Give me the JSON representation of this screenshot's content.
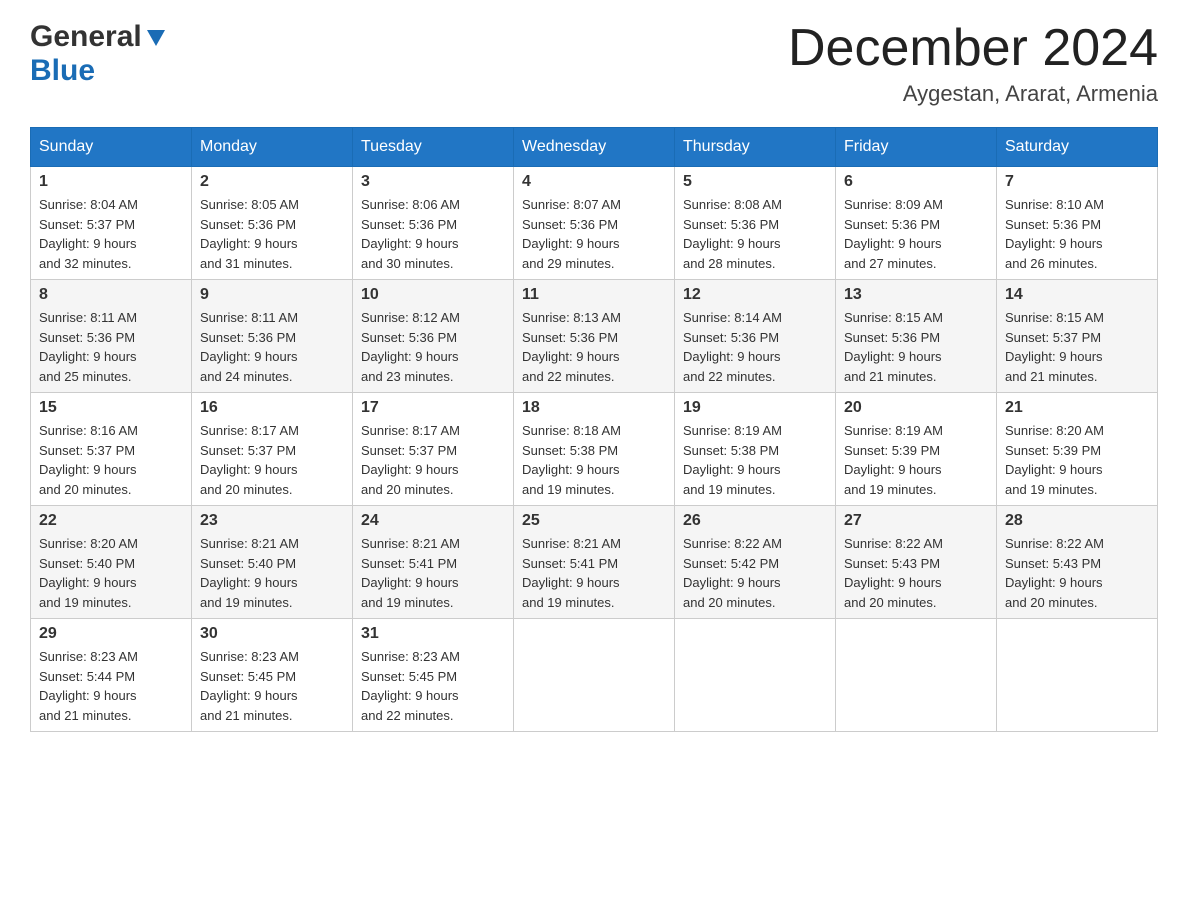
{
  "header": {
    "logo_general": "General",
    "logo_blue": "Blue",
    "title": "December 2024",
    "subtitle": "Aygestan, Ararat, Armenia"
  },
  "calendar": {
    "days_of_week": [
      "Sunday",
      "Monday",
      "Tuesday",
      "Wednesday",
      "Thursday",
      "Friday",
      "Saturday"
    ],
    "weeks": [
      [
        {
          "day": "1",
          "sunrise": "8:04 AM",
          "sunset": "5:37 PM",
          "daylight": "9 hours and 32 minutes."
        },
        {
          "day": "2",
          "sunrise": "8:05 AM",
          "sunset": "5:36 PM",
          "daylight": "9 hours and 31 minutes."
        },
        {
          "day": "3",
          "sunrise": "8:06 AM",
          "sunset": "5:36 PM",
          "daylight": "9 hours and 30 minutes."
        },
        {
          "day": "4",
          "sunrise": "8:07 AM",
          "sunset": "5:36 PM",
          "daylight": "9 hours and 29 minutes."
        },
        {
          "day": "5",
          "sunrise": "8:08 AM",
          "sunset": "5:36 PM",
          "daylight": "9 hours and 28 minutes."
        },
        {
          "day": "6",
          "sunrise": "8:09 AM",
          "sunset": "5:36 PM",
          "daylight": "9 hours and 27 minutes."
        },
        {
          "day": "7",
          "sunrise": "8:10 AM",
          "sunset": "5:36 PM",
          "daylight": "9 hours and 26 minutes."
        }
      ],
      [
        {
          "day": "8",
          "sunrise": "8:11 AM",
          "sunset": "5:36 PM",
          "daylight": "9 hours and 25 minutes."
        },
        {
          "day": "9",
          "sunrise": "8:11 AM",
          "sunset": "5:36 PM",
          "daylight": "9 hours and 24 minutes."
        },
        {
          "day": "10",
          "sunrise": "8:12 AM",
          "sunset": "5:36 PM",
          "daylight": "9 hours and 23 minutes."
        },
        {
          "day": "11",
          "sunrise": "8:13 AM",
          "sunset": "5:36 PM",
          "daylight": "9 hours and 22 minutes."
        },
        {
          "day": "12",
          "sunrise": "8:14 AM",
          "sunset": "5:36 PM",
          "daylight": "9 hours and 22 minutes."
        },
        {
          "day": "13",
          "sunrise": "8:15 AM",
          "sunset": "5:36 PM",
          "daylight": "9 hours and 21 minutes."
        },
        {
          "day": "14",
          "sunrise": "8:15 AM",
          "sunset": "5:37 PM",
          "daylight": "9 hours and 21 minutes."
        }
      ],
      [
        {
          "day": "15",
          "sunrise": "8:16 AM",
          "sunset": "5:37 PM",
          "daylight": "9 hours and 20 minutes."
        },
        {
          "day": "16",
          "sunrise": "8:17 AM",
          "sunset": "5:37 PM",
          "daylight": "9 hours and 20 minutes."
        },
        {
          "day": "17",
          "sunrise": "8:17 AM",
          "sunset": "5:37 PM",
          "daylight": "9 hours and 20 minutes."
        },
        {
          "day": "18",
          "sunrise": "8:18 AM",
          "sunset": "5:38 PM",
          "daylight": "9 hours and 19 minutes."
        },
        {
          "day": "19",
          "sunrise": "8:19 AM",
          "sunset": "5:38 PM",
          "daylight": "9 hours and 19 minutes."
        },
        {
          "day": "20",
          "sunrise": "8:19 AM",
          "sunset": "5:39 PM",
          "daylight": "9 hours and 19 minutes."
        },
        {
          "day": "21",
          "sunrise": "8:20 AM",
          "sunset": "5:39 PM",
          "daylight": "9 hours and 19 minutes."
        }
      ],
      [
        {
          "day": "22",
          "sunrise": "8:20 AM",
          "sunset": "5:40 PM",
          "daylight": "9 hours and 19 minutes."
        },
        {
          "day": "23",
          "sunrise": "8:21 AM",
          "sunset": "5:40 PM",
          "daylight": "9 hours and 19 minutes."
        },
        {
          "day": "24",
          "sunrise": "8:21 AM",
          "sunset": "5:41 PM",
          "daylight": "9 hours and 19 minutes."
        },
        {
          "day": "25",
          "sunrise": "8:21 AM",
          "sunset": "5:41 PM",
          "daylight": "9 hours and 19 minutes."
        },
        {
          "day": "26",
          "sunrise": "8:22 AM",
          "sunset": "5:42 PM",
          "daylight": "9 hours and 20 minutes."
        },
        {
          "day": "27",
          "sunrise": "8:22 AM",
          "sunset": "5:43 PM",
          "daylight": "9 hours and 20 minutes."
        },
        {
          "day": "28",
          "sunrise": "8:22 AM",
          "sunset": "5:43 PM",
          "daylight": "9 hours and 20 minutes."
        }
      ],
      [
        {
          "day": "29",
          "sunrise": "8:23 AM",
          "sunset": "5:44 PM",
          "daylight": "9 hours and 21 minutes."
        },
        {
          "day": "30",
          "sunrise": "8:23 AM",
          "sunset": "5:45 PM",
          "daylight": "9 hours and 21 minutes."
        },
        {
          "day": "31",
          "sunrise": "8:23 AM",
          "sunset": "5:45 PM",
          "daylight": "9 hours and 22 minutes."
        },
        null,
        null,
        null,
        null
      ]
    ]
  }
}
